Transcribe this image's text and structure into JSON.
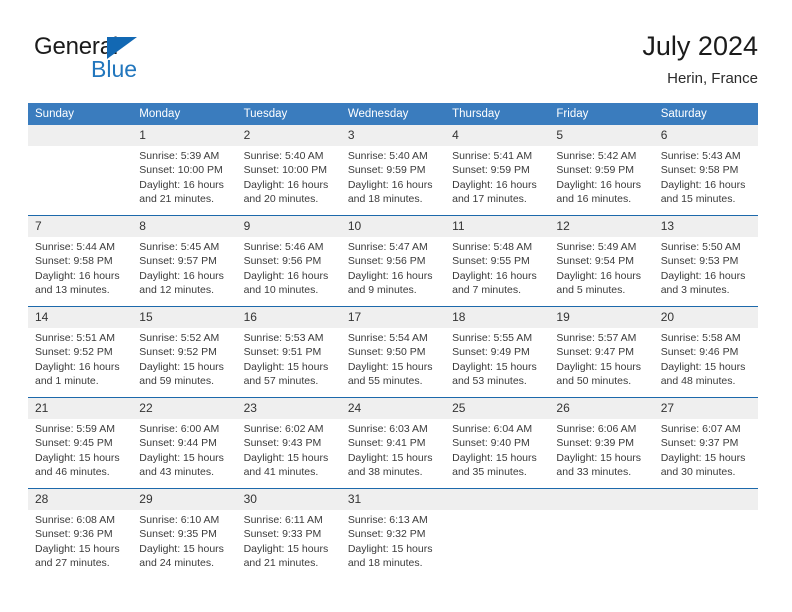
{
  "brand": {
    "name_top": "General",
    "name_bottom": "Blue",
    "accent_color": "#2176bd",
    "triangle_color": "#1268b3"
  },
  "header": {
    "title": "July 2024",
    "subtitle": "Herin, France"
  },
  "theme": {
    "header_bar": "#3a7cbe",
    "week_divider": "#1d69ab",
    "daynum_band": "#efefef",
    "text": "#3b3b3b"
  },
  "columns": [
    "Sunday",
    "Monday",
    "Tuesday",
    "Wednesday",
    "Thursday",
    "Friday",
    "Saturday"
  ],
  "weeks": [
    [
      {
        "day": "",
        "lines": []
      },
      {
        "day": "1",
        "lines": [
          "Sunrise: 5:39 AM",
          "Sunset: 10:00 PM",
          "Daylight: 16 hours",
          "and 21 minutes."
        ]
      },
      {
        "day": "2",
        "lines": [
          "Sunrise: 5:40 AM",
          "Sunset: 10:00 PM",
          "Daylight: 16 hours",
          "and 20 minutes."
        ]
      },
      {
        "day": "3",
        "lines": [
          "Sunrise: 5:40 AM",
          "Sunset: 9:59 PM",
          "Daylight: 16 hours",
          "and 18 minutes."
        ]
      },
      {
        "day": "4",
        "lines": [
          "Sunrise: 5:41 AM",
          "Sunset: 9:59 PM",
          "Daylight: 16 hours",
          "and 17 minutes."
        ]
      },
      {
        "day": "5",
        "lines": [
          "Sunrise: 5:42 AM",
          "Sunset: 9:59 PM",
          "Daylight: 16 hours",
          "and 16 minutes."
        ]
      },
      {
        "day": "6",
        "lines": [
          "Sunrise: 5:43 AM",
          "Sunset: 9:58 PM",
          "Daylight: 16 hours",
          "and 15 minutes."
        ]
      }
    ],
    [
      {
        "day": "7",
        "lines": [
          "Sunrise: 5:44 AM",
          "Sunset: 9:58 PM",
          "Daylight: 16 hours",
          "and 13 minutes."
        ]
      },
      {
        "day": "8",
        "lines": [
          "Sunrise: 5:45 AM",
          "Sunset: 9:57 PM",
          "Daylight: 16 hours",
          "and 12 minutes."
        ]
      },
      {
        "day": "9",
        "lines": [
          "Sunrise: 5:46 AM",
          "Sunset: 9:56 PM",
          "Daylight: 16 hours",
          "and 10 minutes."
        ]
      },
      {
        "day": "10",
        "lines": [
          "Sunrise: 5:47 AM",
          "Sunset: 9:56 PM",
          "Daylight: 16 hours",
          "and 9 minutes."
        ]
      },
      {
        "day": "11",
        "lines": [
          "Sunrise: 5:48 AM",
          "Sunset: 9:55 PM",
          "Daylight: 16 hours",
          "and 7 minutes."
        ]
      },
      {
        "day": "12",
        "lines": [
          "Sunrise: 5:49 AM",
          "Sunset: 9:54 PM",
          "Daylight: 16 hours",
          "and 5 minutes."
        ]
      },
      {
        "day": "13",
        "lines": [
          "Sunrise: 5:50 AM",
          "Sunset: 9:53 PM",
          "Daylight: 16 hours",
          "and 3 minutes."
        ]
      }
    ],
    [
      {
        "day": "14",
        "lines": [
          "Sunrise: 5:51 AM",
          "Sunset: 9:52 PM",
          "Daylight: 16 hours",
          "and 1 minute."
        ]
      },
      {
        "day": "15",
        "lines": [
          "Sunrise: 5:52 AM",
          "Sunset: 9:52 PM",
          "Daylight: 15 hours",
          "and 59 minutes."
        ]
      },
      {
        "day": "16",
        "lines": [
          "Sunrise: 5:53 AM",
          "Sunset: 9:51 PM",
          "Daylight: 15 hours",
          "and 57 minutes."
        ]
      },
      {
        "day": "17",
        "lines": [
          "Sunrise: 5:54 AM",
          "Sunset: 9:50 PM",
          "Daylight: 15 hours",
          "and 55 minutes."
        ]
      },
      {
        "day": "18",
        "lines": [
          "Sunrise: 5:55 AM",
          "Sunset: 9:49 PM",
          "Daylight: 15 hours",
          "and 53 minutes."
        ]
      },
      {
        "day": "19",
        "lines": [
          "Sunrise: 5:57 AM",
          "Sunset: 9:47 PM",
          "Daylight: 15 hours",
          "and 50 minutes."
        ]
      },
      {
        "day": "20",
        "lines": [
          "Sunrise: 5:58 AM",
          "Sunset: 9:46 PM",
          "Daylight: 15 hours",
          "and 48 minutes."
        ]
      }
    ],
    [
      {
        "day": "21",
        "lines": [
          "Sunrise: 5:59 AM",
          "Sunset: 9:45 PM",
          "Daylight: 15 hours",
          "and 46 minutes."
        ]
      },
      {
        "day": "22",
        "lines": [
          "Sunrise: 6:00 AM",
          "Sunset: 9:44 PM",
          "Daylight: 15 hours",
          "and 43 minutes."
        ]
      },
      {
        "day": "23",
        "lines": [
          "Sunrise: 6:02 AM",
          "Sunset: 9:43 PM",
          "Daylight: 15 hours",
          "and 41 minutes."
        ]
      },
      {
        "day": "24",
        "lines": [
          "Sunrise: 6:03 AM",
          "Sunset: 9:41 PM",
          "Daylight: 15 hours",
          "and 38 minutes."
        ]
      },
      {
        "day": "25",
        "lines": [
          "Sunrise: 6:04 AM",
          "Sunset: 9:40 PM",
          "Daylight: 15 hours",
          "and 35 minutes."
        ]
      },
      {
        "day": "26",
        "lines": [
          "Sunrise: 6:06 AM",
          "Sunset: 9:39 PM",
          "Daylight: 15 hours",
          "and 33 minutes."
        ]
      },
      {
        "day": "27",
        "lines": [
          "Sunrise: 6:07 AM",
          "Sunset: 9:37 PM",
          "Daylight: 15 hours",
          "and 30 minutes."
        ]
      }
    ],
    [
      {
        "day": "28",
        "lines": [
          "Sunrise: 6:08 AM",
          "Sunset: 9:36 PM",
          "Daylight: 15 hours",
          "and 27 minutes."
        ]
      },
      {
        "day": "29",
        "lines": [
          "Sunrise: 6:10 AM",
          "Sunset: 9:35 PM",
          "Daylight: 15 hours",
          "and 24 minutes."
        ]
      },
      {
        "day": "30",
        "lines": [
          "Sunrise: 6:11 AM",
          "Sunset: 9:33 PM",
          "Daylight: 15 hours",
          "and 21 minutes."
        ]
      },
      {
        "day": "31",
        "lines": [
          "Sunrise: 6:13 AM",
          "Sunset: 9:32 PM",
          "Daylight: 15 hours",
          "and 18 minutes."
        ]
      },
      {
        "day": "",
        "lines": []
      },
      {
        "day": "",
        "lines": []
      },
      {
        "day": "",
        "lines": []
      }
    ]
  ]
}
